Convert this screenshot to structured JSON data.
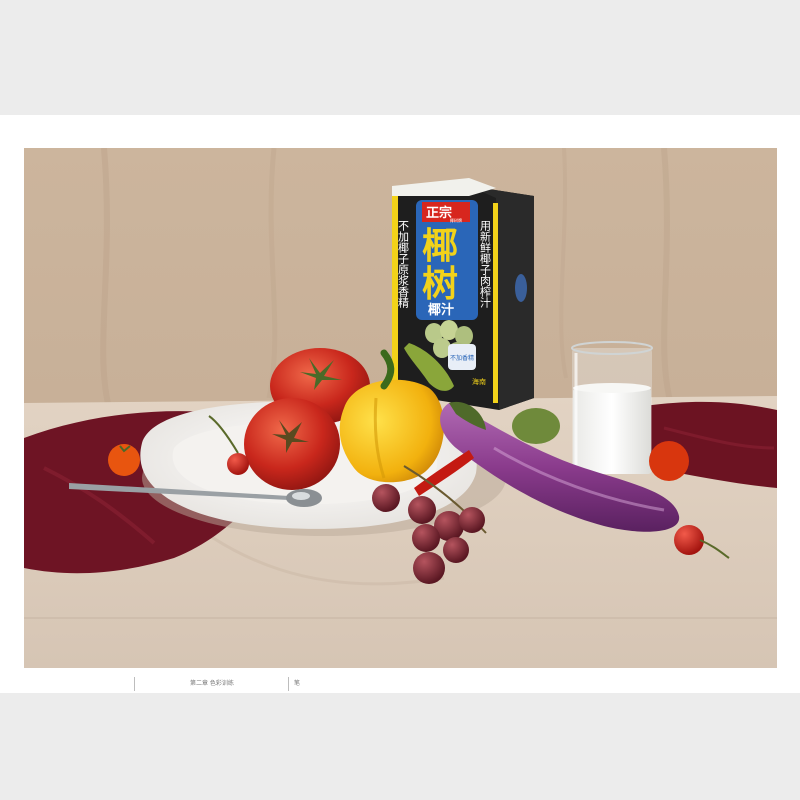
{
  "package": {
    "brand_badge": "正宗",
    "badge_small": "椰树牌",
    "main_name": "椰树",
    "sub_name": "椰汁",
    "left_slogan": "不加椰子原浆香精",
    "right_slogan": "用新鲜椰子肉榨汁",
    "label_small": "不加香精",
    "bottom_small": "海南"
  },
  "footer": {
    "chapter": "第二章  色彩训练",
    "page_mark": "笔"
  },
  "colors": {
    "background_cloth": "#cfb79e",
    "table_cloth": "#ddcdbd",
    "red_napkin": "#6e1424",
    "carton_black": "#1e1e1e",
    "carton_yellow": "#f2d21a",
    "carton_blue": "#2a66b8"
  }
}
